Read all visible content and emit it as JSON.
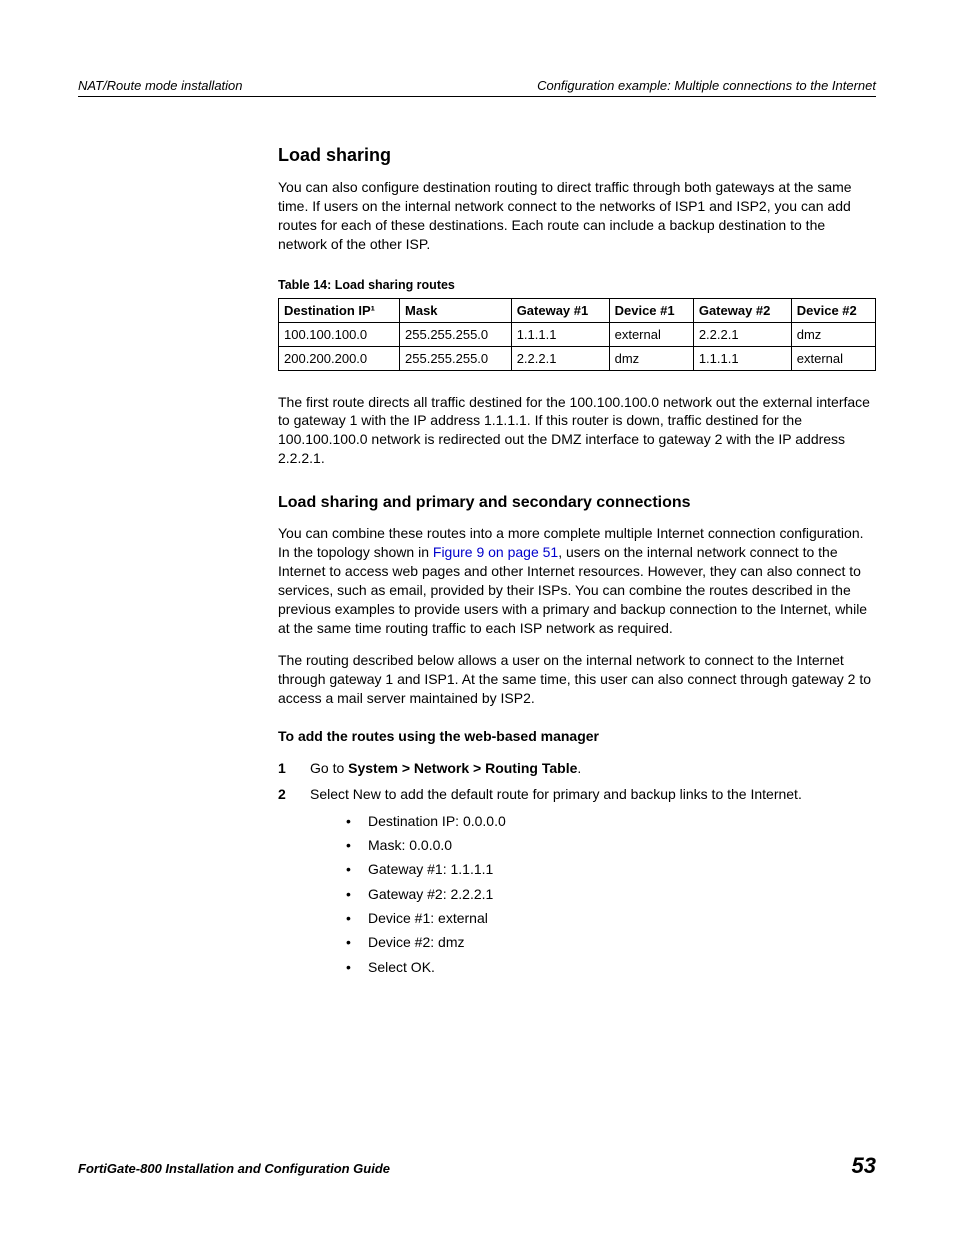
{
  "header": {
    "left": "NAT/Route mode installation",
    "right": "Configuration example: Multiple connections to the Internet"
  },
  "section1": {
    "title": "Load sharing",
    "para1": "You can also configure destination routing to direct traffic through both gateways at the same time. If users on the internal network connect to the networks of ISP1 and ISP2, you can add routes for each of these destinations. Each route can include a backup destination to the network of the other ISP.",
    "table_caption": "Table 14: Load sharing routes",
    "table_headers": [
      "Destination IP¹",
      "Mask",
      "Gateway #1",
      "Device #1",
      "Gateway #2",
      "Device #2"
    ],
    "table_rows": [
      [
        "100.100.100.0",
        "255.255.255.0",
        "1.1.1.1",
        "external",
        "2.2.2.1",
        "dmz"
      ],
      [
        "200.200.200.0",
        "255.255.255.0",
        "2.2.2.1",
        "dmz",
        "1.1.1.1",
        "external"
      ]
    ],
    "para2": "The first route directs all traffic destined for the 100.100.100.0 network out the external interface to gateway 1 with the IP address 1.1.1.1. If this router is down, traffic destined for the 100.100.100.0 network is redirected out the DMZ interface to gateway 2 with the IP address 2.2.2.1."
  },
  "section2": {
    "title": "Load sharing and primary and secondary connections",
    "para1_a": "You can combine these routes into a more complete multiple Internet connection configuration. In the topology shown in ",
    "para1_link": "Figure 9 on page 51",
    "para1_b": ", users on the internal network connect to the Internet to access web pages and other Internet resources. However, they can also connect to services, such as email, provided by their ISPs. You can combine the routes described in the previous examples to provide users with a primary and backup connection to the Internet, while at the same time routing traffic to each ISP network as required.",
    "para2": "The routing described below allows a user on the internal network to connect to the Internet through gateway 1 and ISP1. At the same time, this user can also connect through gateway 2 to access a mail server maintained by ISP2.",
    "instr_title": "To add the routes using the web-based manager",
    "steps": {
      "s1_prefix": "Go to ",
      "s1_bold": "System > Network > Routing Table",
      "s1_suffix": ".",
      "s2": "Select New to add the default route for primary and backup links to the Internet.",
      "bullets": [
        "Destination IP: 0.0.0.0",
        "Mask: 0.0.0.0",
        "Gateway #1: 1.1.1.1",
        "Gateway #2: 2.2.2.1",
        "Device #1: external",
        "Device #2: dmz",
        "Select OK."
      ]
    }
  },
  "footer": {
    "guide": "FortiGate-800 Installation and Configuration Guide",
    "page": "53"
  },
  "labels": {
    "n1": "1",
    "n2": "2",
    "dot": "•"
  }
}
